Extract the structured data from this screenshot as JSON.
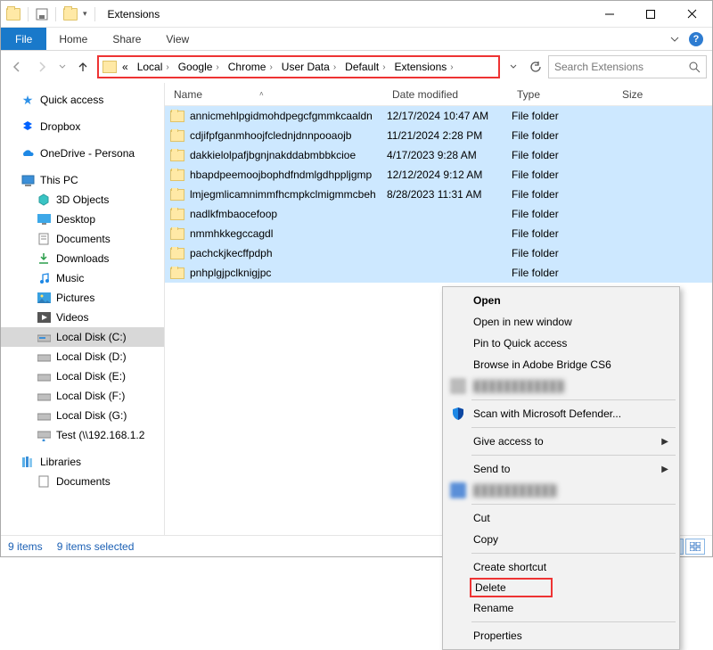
{
  "window": {
    "title": "Extensions"
  },
  "ribbon": {
    "file": "File",
    "home": "Home",
    "share": "Share",
    "view": "View"
  },
  "breadcrumb": {
    "overflow": "«",
    "items": [
      "Local",
      "Google",
      "Chrome",
      "User Data",
      "Default",
      "Extensions"
    ]
  },
  "search": {
    "placeholder": "Search Extensions"
  },
  "columns": {
    "name": "Name",
    "date": "Date modified",
    "type": "Type",
    "size": "Size"
  },
  "tree": {
    "quick_access": "Quick access",
    "dropbox": "Dropbox",
    "onedrive": "OneDrive - Persona",
    "this_pc": "This PC",
    "objects3d": "3D Objects",
    "desktop": "Desktop",
    "documents": "Documents",
    "downloads": "Downloads",
    "music": "Music",
    "pictures": "Pictures",
    "videos": "Videos",
    "disk_c": "Local Disk (C:)",
    "disk_d": "Local Disk (D:)",
    "disk_e": "Local Disk (E:)",
    "disk_f": "Local Disk (F:)",
    "disk_g": "Local Disk (G:)",
    "net_test": "Test (\\\\192.168.1.2",
    "libraries": "Libraries",
    "lib_documents": "Documents"
  },
  "files": [
    {
      "name": "annicmehlpgidmohdpegcfgmmkcaaldn",
      "date": "12/17/2024 10:47 AM",
      "type": "File folder"
    },
    {
      "name": "cdjifpfganmhoojfclednjdnnpooaojb",
      "date": "11/21/2024 2:28 PM",
      "type": "File folder"
    },
    {
      "name": "dakkielolpafjbgnjnakddabmbbkcioe",
      "date": "4/17/2023 9:28 AM",
      "type": "File folder"
    },
    {
      "name": "hbapdpeemoojbophdfndmlgdhppljgmp",
      "date": "12/12/2024 9:12 AM",
      "type": "File folder"
    },
    {
      "name": "lmjegmlicamnimmfhcmpkclmigmmcbeh",
      "date": "8/28/2023 11:31 AM",
      "type": "File folder"
    },
    {
      "name": "nadlkfmbaocefoop",
      "date": "",
      "type": "File folder"
    },
    {
      "name": "nmmhkkegccagdl",
      "date": "",
      "type": "File folder"
    },
    {
      "name": "pachckjkecffpdph",
      "date": "",
      "type": "File folder"
    },
    {
      "name": "pnhplgjpclknigjpc",
      "date": "",
      "type": "File folder"
    }
  ],
  "context_menu": {
    "open": "Open",
    "open_new": "Open in new window",
    "pin_quick": "Pin to Quick access",
    "bridge": "Browse in Adobe Bridge CS6",
    "defender": "Scan with Microsoft Defender...",
    "give_access": "Give access to",
    "send_to": "Send to",
    "cut": "Cut",
    "copy": "Copy",
    "shortcut": "Create shortcut",
    "delete": "Delete",
    "rename": "Rename",
    "properties": "Properties"
  },
  "status": {
    "items": "9 items",
    "selected": "9 items selected"
  }
}
